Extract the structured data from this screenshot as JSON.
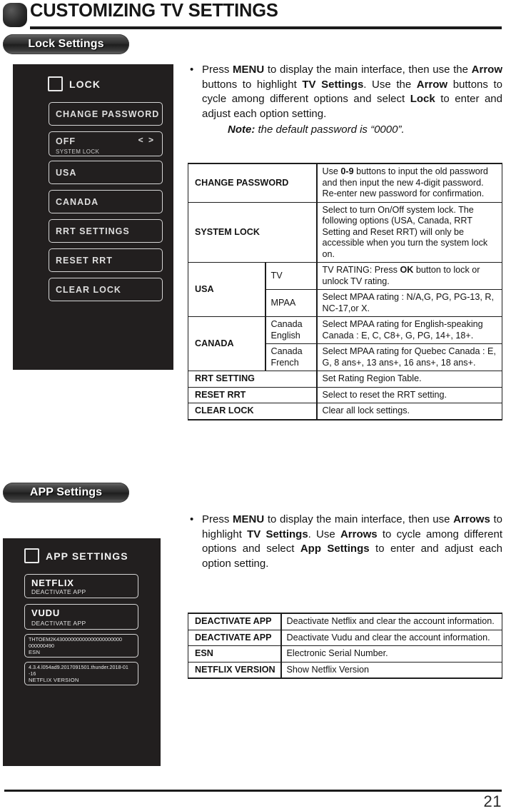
{
  "header": {
    "title": "CUSTOMIZING TV SETTINGS"
  },
  "sections": {
    "lock": {
      "badge_label": "Lock Settings",
      "osd": {
        "checkbox_label": "LOCK",
        "items": [
          {
            "label": "CHANGE PASSWORD",
            "sub": "",
            "arrows": ""
          },
          {
            "label": "OFF",
            "sub": "SYSTEM LOCK",
            "arrows": "< >"
          },
          {
            "label": "USA",
            "sub": "",
            "arrows": ""
          },
          {
            "label": "CANADA",
            "sub": "",
            "arrows": ""
          },
          {
            "label": "RRT SETTINGS",
            "sub": "",
            "arrows": ""
          },
          {
            "label": "RESET RRT",
            "sub": "",
            "arrows": ""
          },
          {
            "label": "CLEAR LOCK",
            "sub": "",
            "arrows": ""
          }
        ]
      },
      "instruction": {
        "bullet": "•",
        "line1_a": "Press ",
        "line1_b": "MENU",
        "line1_c": " to display the main interface, then use the ",
        "line1_d": "Arrow",
        "line1_e": " buttons to highlight ",
        "line1_f": "TV Settings",
        "line1_g": ". Use the ",
        "line1_h": "Arrow",
        "line1_i": " buttons to cycle among different options and select ",
        "line1_j": "Lock",
        "line1_k": " to enter and adjust each option setting.",
        "note_label": "Note:",
        "note_text": " the default password is “0000”."
      },
      "table": [
        {
          "key": "CHANGE PASSWORD",
          "sub": null,
          "desc_a": "Use ",
          "desc_b": "0-9",
          "desc_c": " buttons to input the old password and then input the new 4-digit password. Re-enter new password for confirmation."
        },
        {
          "key": "SYSTEM LOCK",
          "sub": null,
          "desc_a": "Select to turn On/Off system lock. The following options (USA, Canada, RRT Setting and Reset RRT) will only be accessible when you turn the system lock on.",
          "desc_b": "",
          "desc_c": ""
        },
        {
          "key": "USA",
          "sub": "TV",
          "desc_a": "TV RATING: Press ",
          "desc_b": "OK",
          "desc_c": " button to lock or unlock TV rating."
        },
        {
          "key": null,
          "sub": "MPAA",
          "desc_a": "Select MPAA rating : N/A,G, PG, PG-13, R, NC-17,or X.",
          "desc_b": "",
          "desc_c": ""
        },
        {
          "key": "CANADA",
          "sub": "Canada English",
          "desc_a": "Select MPAA rating for English-speaking Canada : E, C, C8+, G, PG, 14+, 18+.",
          "desc_b": "",
          "desc_c": ""
        },
        {
          "key": null,
          "sub": "Canada French",
          "desc_a": "Select MPAA rating for Quebec Canada : E, G, 8 ans+, 13 ans+, 16 ans+, 18 ans+.",
          "desc_b": "",
          "desc_c": ""
        },
        {
          "key": "RRT SETTING",
          "sub": null,
          "desc_a": "Set Rating Region Table.",
          "desc_b": "",
          "desc_c": ""
        },
        {
          "key": "RESET RRT",
          "sub": null,
          "desc_a": "Select to reset the RRT setting.",
          "desc_b": "",
          "desc_c": ""
        },
        {
          "key": "CLEAR LOCK",
          "sub": null,
          "desc_a": "Clear all lock settings.",
          "desc_b": "",
          "desc_c": ""
        }
      ]
    },
    "app": {
      "badge_label": "APP Settings",
      "osd": {
        "checkbox_label": "APP SETTINGS",
        "items": [
          {
            "title": "NETFLIX",
            "sub": "DEACTIVATE APP"
          },
          {
            "title": "VUDU",
            "sub": "DEACTIVATE APP"
          }
        ],
        "info": [
          {
            "value_line1": "THTOEM2K43000000000000000000000",
            "value_line2": "000000490",
            "label": "ESN"
          },
          {
            "value_line1": "4.3.4.l054ad9.2017091501.thunder.2018-01",
            "value_line2": "-16",
            "label": "NETFLIX VERSION"
          }
        ]
      },
      "instruction": {
        "bullet": "•",
        "line1_a": "Press ",
        "line1_b": "MENU",
        "line1_c": " to display the main interface, then use ",
        "line1_d": "Arrows",
        "line1_e": " to highlight ",
        "line1_f": "TV Settings",
        "line1_g": ". Use ",
        "line1_h": "Arrows",
        "line1_i": " to cycle among different options and select ",
        "line1_j": "App Settings",
        "line1_k": " to enter and adjust each option setting."
      },
      "table": [
        {
          "key": "DEACTIVATE APP",
          "desc": "Deactivate Netflix and clear the account information."
        },
        {
          "key": "DEACTIVATE APP",
          "desc": "Deactivate Vudu and clear the account information."
        },
        {
          "key": "ESN",
          "desc": "Electronic Serial Number."
        },
        {
          "key": "NETFLIX VERSION",
          "desc": "Show Netflix Version"
        }
      ]
    }
  },
  "footer": {
    "page_number": "21"
  }
}
